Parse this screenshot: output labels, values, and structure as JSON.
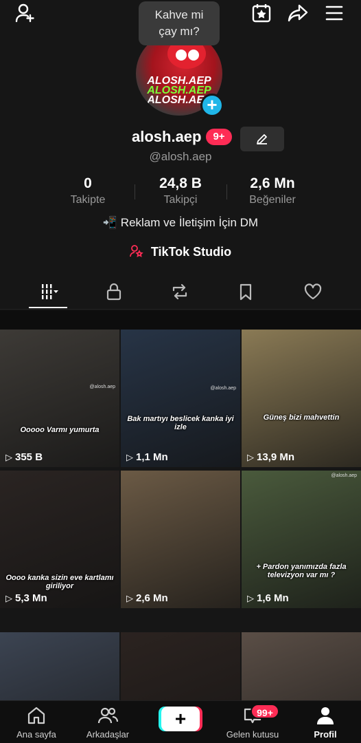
{
  "tooltip": {
    "line1": "Kahve mi",
    "line2": "çay mı?"
  },
  "avatar": {
    "text": "ALOSH.AEP"
  },
  "profile": {
    "username": "alosh.aep",
    "notification_count": "9+",
    "handle": "@alosh.aep",
    "bio": "📲 Reklam ve İletişim İçin DM",
    "studio_label": "TikTok Studio"
  },
  "stats": [
    {
      "value": "0",
      "label": "Takipte"
    },
    {
      "value": "24,8 B",
      "label": "Takipçi"
    },
    {
      "value": "2,6 Mn",
      "label": "Beğeniler"
    }
  ],
  "tabs": [
    "videos-grid",
    "private",
    "reposts",
    "favorites",
    "liked"
  ],
  "videos": [
    {
      "views": "355 B",
      "caption": "Ooooo Varmı yumurta",
      "bg": "#3d3a36"
    },
    {
      "views": "1,1 Mn",
      "caption": "Bak martıyı beslicek kanka iyi izle",
      "bg": "#273446"
    },
    {
      "views": "13,9 Mn",
      "caption": "Güneş bizi mahvettin",
      "bg": "#8a7a55"
    },
    {
      "views": "5,3 Mn",
      "caption": "Oooo kanka sizin eve kartlamı giriliyor",
      "bg": "#2a2422"
    },
    {
      "views": "2,6 Mn",
      "caption": "",
      "bg": "#6b5a45"
    },
    {
      "views": "1,6 Mn",
      "caption": "+ Pardon yanımızda fazla televizyon var mı ?",
      "bg": "#4a5a3c"
    },
    {
      "views": "",
      "caption": "",
      "bg": "#3c4452"
    },
    {
      "views": "",
      "caption": "",
      "bg": "#2b2320"
    },
    {
      "views": "",
      "caption": "",
      "bg": "#5a4e46"
    }
  ],
  "watermarks": {
    "cell1": "@alosh.aep",
    "cell2": "@alosh.aep",
    "cell6": "@alosh.aep"
  },
  "nav": {
    "home": "Ana sayfa",
    "friends": "Arkadaşlar",
    "create": "+",
    "inbox": "Gelen kutusu",
    "inbox_badge": "99+",
    "profile": "Profil"
  },
  "colors": {
    "accent": "#fe2c55",
    "cyan": "#25f4ee",
    "bg": "#161616"
  }
}
